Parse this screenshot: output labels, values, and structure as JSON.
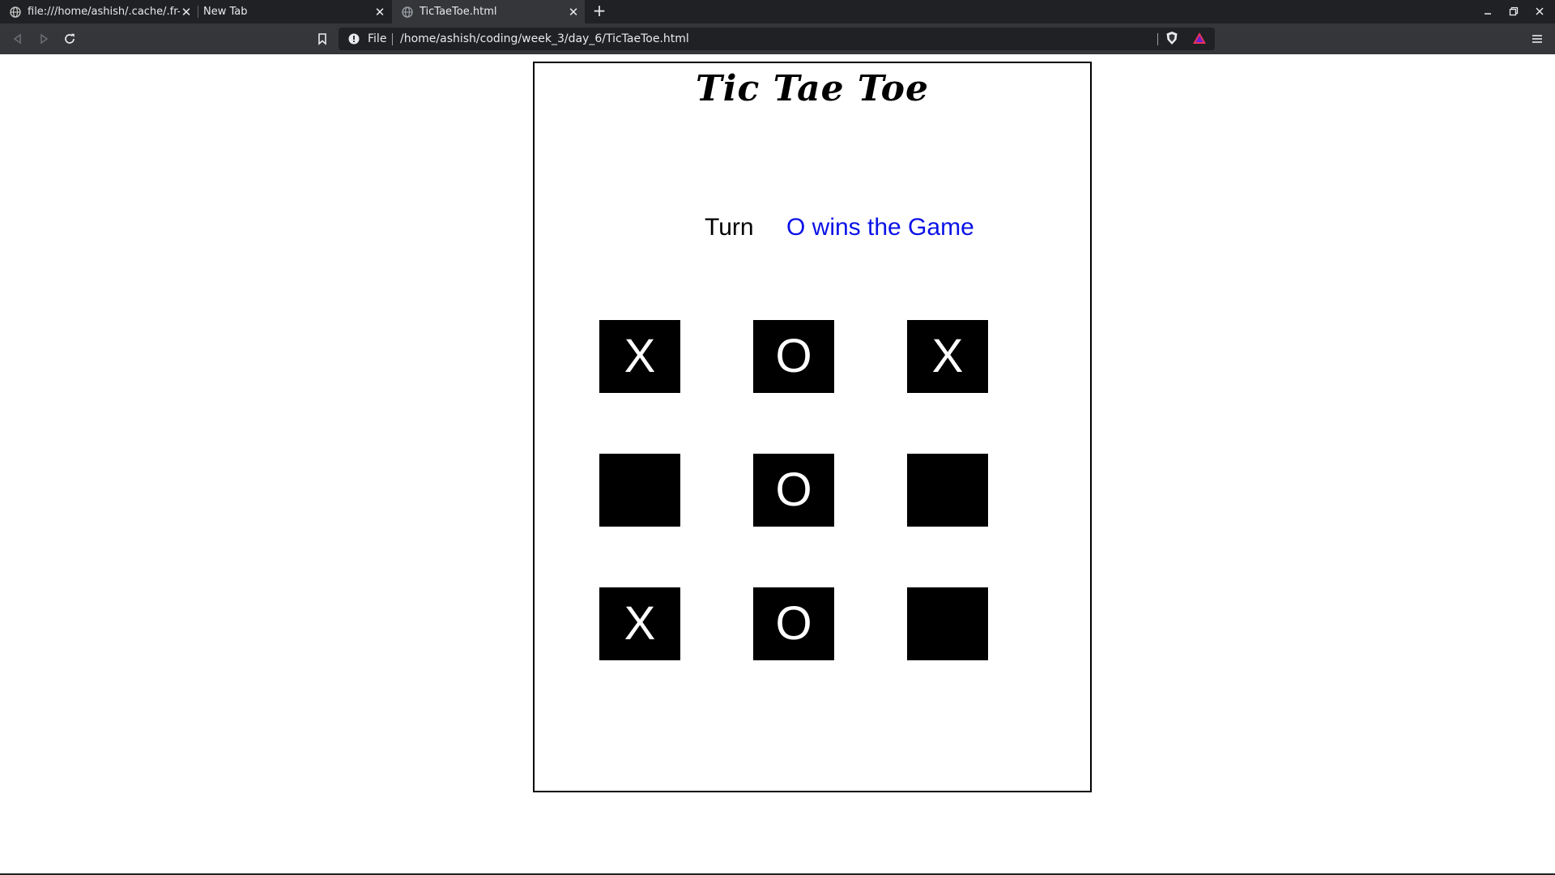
{
  "browser": {
    "tabs": [
      {
        "title": "file:///home/ashish/.cache/.fr-u",
        "active": false
      },
      {
        "title": "New Tab",
        "active": false
      },
      {
        "title": "TicTaeToe.html",
        "active": true
      }
    ],
    "address": {
      "scheme_label": "File",
      "url": "/home/ashish/coding/week_3/day_6/TicTaeToe.html"
    }
  },
  "game": {
    "title": "Tic Tae Toe",
    "turn_label": "Turn",
    "status": "O wins the Game",
    "status_color": "#0a12e6",
    "board": [
      [
        "X",
        "O",
        "X"
      ],
      [
        "",
        "O",
        ""
      ],
      [
        "X",
        "O",
        ""
      ]
    ]
  },
  "colors": {
    "tab_strip": "#202124",
    "toolbar": "#35363a",
    "cell_bg": "#000000",
    "cell_text": "#ffffff"
  }
}
